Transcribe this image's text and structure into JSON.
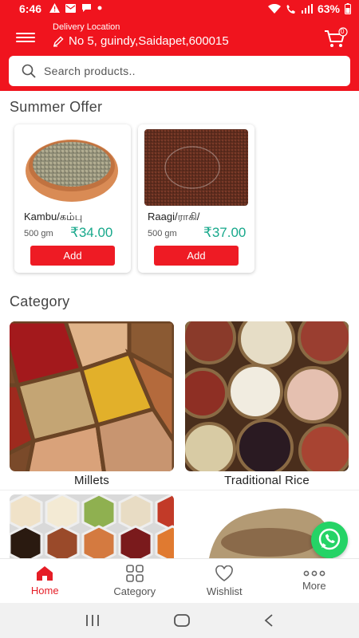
{
  "status": {
    "time": "6:46",
    "battery": "63%"
  },
  "header": {
    "delivery_label": "Delivery Location",
    "address": "No 5, guindy,Saidapet,600015",
    "cart_count": "0"
  },
  "search": {
    "placeholder": "Search products.."
  },
  "summer": {
    "title": "Summer Offer",
    "products": [
      {
        "name": "Kambu/கம்பு",
        "qty": "500 gm",
        "price": "₹34.00",
        "add": "Add"
      },
      {
        "name": "Raagi/ராகி/",
        "qty": "500 gm",
        "price": "₹37.00",
        "add": "Add"
      }
    ]
  },
  "category": {
    "title": "Category",
    "items": [
      {
        "label": "Millets"
      },
      {
        "label": "Traditional Rice"
      }
    ]
  },
  "nav": {
    "items": [
      {
        "label": "Home"
      },
      {
        "label": "Category"
      },
      {
        "label": "Wishlist"
      },
      {
        "label": "More"
      }
    ]
  },
  "colors": {
    "brand": "#f0141e",
    "price": "#17a88b",
    "add_button": "#ee1b24",
    "active_nav": "#e51d26"
  }
}
